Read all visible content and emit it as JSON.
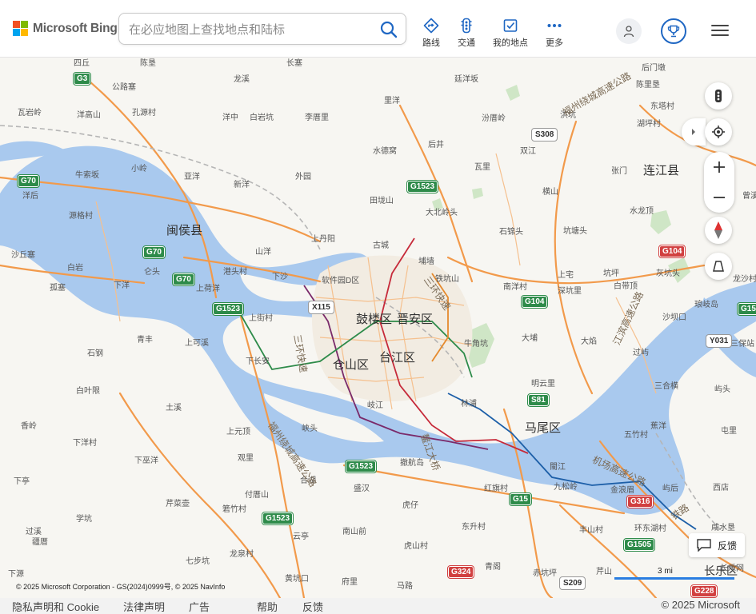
{
  "brand": {
    "name": "Microsoft Bing"
  },
  "search": {
    "placeholder": "在必应地图上查找地点和陆标",
    "value": ""
  },
  "nav": [
    {
      "label": "路线",
      "icon": "directions-icon"
    },
    {
      "label": "交通",
      "icon": "traffic-icon"
    },
    {
      "label": "我的地点",
      "icon": "my-places-icon"
    },
    {
      "label": "更多",
      "icon": "more-icon"
    }
  ],
  "map": {
    "districts": [
      "鼓楼区",
      "晋安区",
      "台江区",
      "仓山区",
      "马尾区",
      "闽侯县",
      "连江县",
      "长乐区"
    ],
    "places": [
      "四丘",
      "陈垦",
      "长塞",
      "龙溪",
      "廷洋坂",
      "后门墩",
      "公路塞",
      "瓦岩岭",
      "洋高山",
      "孔源村",
      "里洋",
      "洪坑",
      "陈里垦",
      "洋中",
      "白岩坑",
      "李厝里",
      "汾厝岭",
      "东塔村",
      "湖坪村",
      "水德窝",
      "后井",
      "双江",
      "牛索坂",
      "小岭",
      "亚洋",
      "外园",
      "瓦里",
      "张门",
      "洋后",
      "新洋",
      "田垅山",
      "大北岭头",
      "横山",
      "曾溪",
      "水龙顶",
      "源格村",
      "上丹阳",
      "石锦头",
      "坑塘头",
      "沙丘塞",
      "白岩",
      "山洋",
      "古城",
      "埔墙",
      "灰坑头",
      "孤塞",
      "仑头",
      "下洋",
      "港头村",
      "下沙",
      "软件园D区",
      "铁坑山",
      "上宅",
      "坑坪",
      "龙沙村",
      "上荷洋",
      "上街村",
      "南洋村",
      "深坑里",
      "白带顶",
      "沙坝口",
      "青丰",
      "上可溪",
      "下长安",
      "牛角坑",
      "大埔",
      "大焰",
      "琅岐岛",
      "石钢",
      "白叶限",
      "明云里",
      "过屿",
      "三保站",
      "香岭",
      "土溪",
      "林浦",
      "三合横",
      "屿头",
      "上元顶",
      "峡头",
      "岐江",
      "五竹村",
      "蕉洋",
      "屯里",
      "下洋村",
      "下巫洋",
      "观里",
      "閩江",
      "九松岭",
      "金浪眉",
      "屿后",
      "西店",
      "下亭",
      "芹菜壶",
      "付厝山",
      "盛汉",
      "虎仔",
      "红旗村",
      "撤航岛",
      "过溪",
      "学坑",
      "箬竹村",
      "合湖",
      "东升村",
      "丰山村",
      "环东湖村",
      "咸水垦",
      "疆厝",
      "云亭",
      "南山前",
      "虎山村",
      "长乐网",
      "七步坑",
      "龙泉村",
      "马路",
      "府里",
      "芹山",
      "赤坑坪",
      "下源",
      "黄坑口",
      "青阁"
    ],
    "shields": [
      {
        "text": "G3",
        "color": "green"
      },
      {
        "text": "G70",
        "color": "green"
      },
      {
        "text": "G70",
        "color": "green"
      },
      {
        "text": "G70",
        "color": "green"
      },
      {
        "text": "G1523",
        "color": "green"
      },
      {
        "text": "G1523",
        "color": "green"
      },
      {
        "text": "G1523",
        "color": "green"
      },
      {
        "text": "G1523",
        "color": "green"
      },
      {
        "text": "G104",
        "color": "green"
      },
      {
        "text": "G104",
        "color": "red"
      },
      {
        "text": "G15",
        "color": "green"
      },
      {
        "text": "G1505",
        "color": "green"
      },
      {
        "text": "G1501",
        "color": "green"
      },
      {
        "text": "S308",
        "color": "white"
      },
      {
        "text": "S81",
        "color": "green"
      },
      {
        "text": "X115",
        "color": "white"
      },
      {
        "text": "Y031",
        "color": "white"
      },
      {
        "text": "G316",
        "color": "red"
      },
      {
        "text": "G324",
        "color": "red"
      },
      {
        "text": "S209",
        "color": "white"
      },
      {
        "text": "G228",
        "color": "red"
      }
    ],
    "roads": [
      "福州绕城高速公路",
      "福州绕城高速公路",
      "三环快速",
      "三环快速",
      "机场高速公路",
      "铁路",
      "江滨高速公路",
      "鳌江大桥"
    ],
    "scale": "3 mi",
    "attribution": "© 2025 Microsoft Corporation - GS(2024)0999号, © 2025 NavInfo",
    "feedback": "反馈"
  },
  "footer": {
    "links": [
      "隐私声明和 Cookie",
      "法律声明",
      "广告",
      "帮助",
      "反馈"
    ],
    "copyright": "© 2025 Microsoft"
  },
  "colors": {
    "water": "#a8c8ec",
    "land": "#f7f6f2",
    "highway": "#f29a4b",
    "green": "#c9e3c0",
    "accent": "#1f67c3"
  }
}
